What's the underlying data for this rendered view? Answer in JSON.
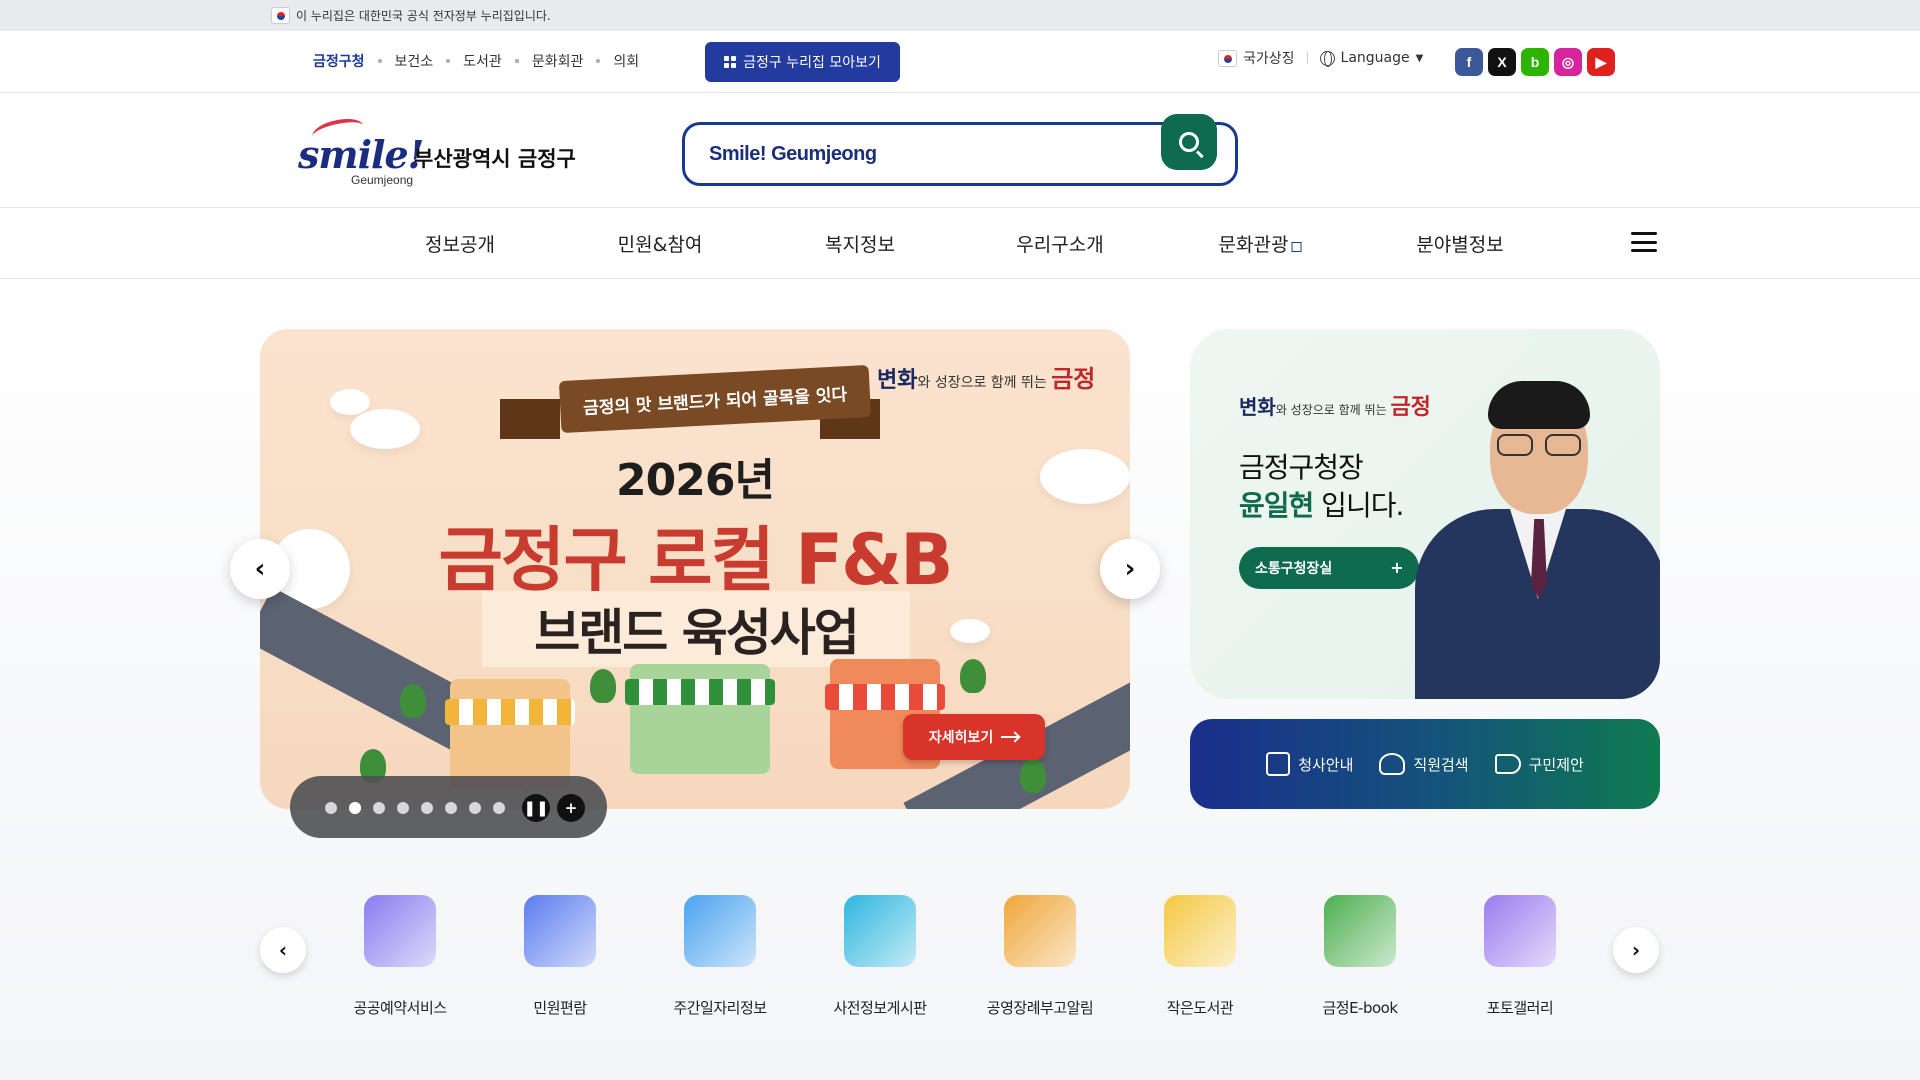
{
  "gov_banner": {
    "text": "이 누리집은 대한민국 공식 전자정부 누리집입니다."
  },
  "utility": {
    "links": [
      "금정구청",
      "보건소",
      "도서관",
      "문화회관",
      "의회"
    ],
    "collect_button": "금정구 누리집 모아보기",
    "national_symbol": "국가상징",
    "language": "Language",
    "social": [
      {
        "icon": "facebook-icon",
        "glyph": "f",
        "color": "#3b5998"
      },
      {
        "icon": "x-icon",
        "glyph": "X",
        "color": "#111111"
      },
      {
        "icon": "band-icon",
        "glyph": "b",
        "color": "#2db400"
      },
      {
        "icon": "instagram-icon",
        "glyph": "◎",
        "color": "#d6249f"
      },
      {
        "icon": "youtube-icon",
        "glyph": "▶",
        "color": "#e0201c"
      }
    ]
  },
  "header": {
    "logo_smile": "smile!",
    "logo_sub": "Geumjeong",
    "city_name": "부산광역시 금정구",
    "search_value": "Smile! Geumjeong"
  },
  "gnb": {
    "items": [
      "정보공개",
      "민원&참여",
      "복지정보",
      "우리구소개",
      "문화관광",
      "분야별정보"
    ]
  },
  "banner": {
    "ribbon": "금정의 맛 브랜드가 되어 골목을 잇다",
    "slogan_a": "변화",
    "slogan_b": "와 성장으로 함께 뛰는 ",
    "slogan_c": "금정",
    "year": "2026년",
    "headline": "금정구 로컬 F&B",
    "subheadline": "브랜드 육성사업",
    "detail_button": "자세히보기",
    "slide_count": 8,
    "active_slide": 2
  },
  "mayor": {
    "slogan_a": "변화",
    "slogan_b": "와 성장으로 함께 뛰는 ",
    "slogan_c": "금정",
    "line1": "금정구청장",
    "name": "윤일현",
    "line2_suffix": " 입니다.",
    "button": "소통구청장실",
    "button_plus": "+"
  },
  "quick_links": [
    "청사안내",
    "직원검색",
    "구민제안"
  ],
  "services": [
    {
      "label": "공공예약서비스",
      "icon": "calendar-icon",
      "color": "#8a7cf0"
    },
    {
      "label": "민원편람",
      "icon": "magnifier-book-icon",
      "color": "#5b7cf0"
    },
    {
      "label": "주간일자리정보",
      "icon": "id-badge-icon",
      "color": "#4aa3f0"
    },
    {
      "label": "사전정보게시판",
      "icon": "monitor-check-icon",
      "color": "#2fb6e0"
    },
    {
      "label": "공영장례부고알림",
      "icon": "bell-icon",
      "color": "#f0a63a"
    },
    {
      "label": "작은도서관",
      "icon": "books-icon",
      "color": "#f5c842"
    },
    {
      "label": "금정E-book",
      "icon": "ebook-icon",
      "color": "#4caf50"
    },
    {
      "label": "포토갤러리",
      "icon": "camera-icon",
      "color": "#9b7cf0"
    }
  ]
}
